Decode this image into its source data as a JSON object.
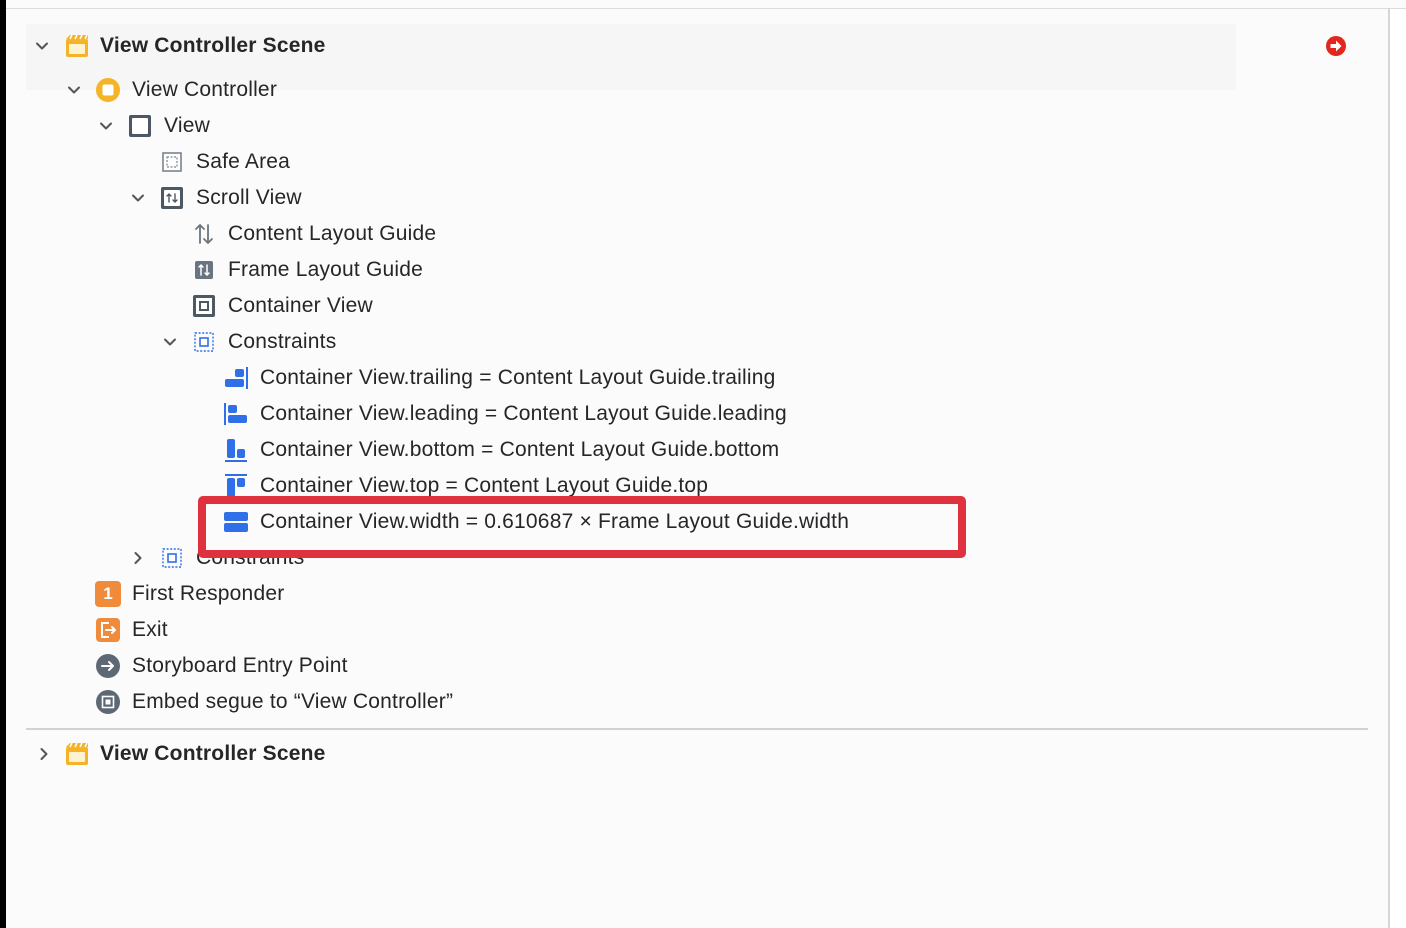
{
  "colors": {
    "accent_blue": "#2f6fe8",
    "scene_yellow": "#f5b327",
    "responder_orange": "#f08b3c",
    "highlight_red": "#e0323e",
    "warning_red": "#e2261d"
  },
  "scenes": [
    {
      "title": "View Controller Scene",
      "expanded": true,
      "tree": {
        "view_controller": "View Controller",
        "view": "View",
        "safe_area": "Safe Area",
        "scroll_view": "Scroll View",
        "content_layout_guide": "Content Layout Guide",
        "frame_layout_guide": "Frame Layout Guide",
        "container_view": "Container View",
        "constraints_inner": "Constraints",
        "constraint_items": [
          {
            "icon": "trailing-constraint-icon",
            "label": "Container View.trailing = Content Layout Guide.trailing"
          },
          {
            "icon": "leading-constraint-icon",
            "label": "Container View.leading = Content Layout Guide.leading"
          },
          {
            "icon": "bottom-constraint-icon",
            "label": "Container View.bottom = Content Layout Guide.bottom"
          },
          {
            "icon": "top-constraint-icon",
            "label": "Container View.top = Content Layout Guide.top"
          },
          {
            "icon": "width-constraint-icon",
            "label": "Container View.width = 0.610687 × Frame Layout Guide.width",
            "highlighted": true
          }
        ],
        "constraints_outer": "Constraints",
        "first_responder": "First Responder",
        "first_responder_badge": "1",
        "exit": "Exit",
        "entry_point": "Storyboard Entry Point",
        "embed_segue": "Embed segue to “View Controller”"
      }
    },
    {
      "title": "View Controller Scene",
      "expanded": false
    }
  ]
}
